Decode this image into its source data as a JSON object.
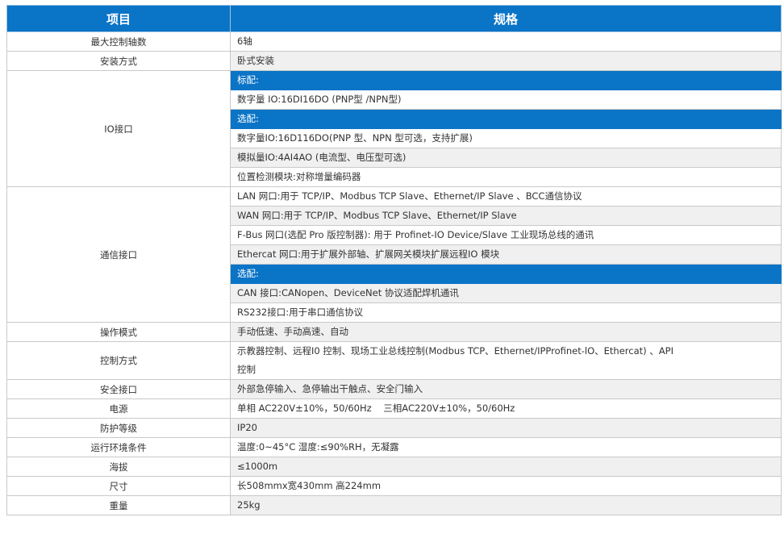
{
  "header": {
    "col1": "项目",
    "col2": "规格"
  },
  "rows": {
    "axes": {
      "label": "最大控制轴数",
      "value": "6轴"
    },
    "install": {
      "label": "安装方式",
      "value": "卧式安装"
    },
    "io": {
      "label": "IO接口",
      "std_title": "标配:",
      "std_digital": "数字量 IO:16DI16DO (PNP型 /NPN型)",
      "opt_title": "选配:",
      "opt_digital": "数字量IO:16D116DO(PNP 型、NPN 型可选，支持扩展)",
      "opt_analog": "模拟量IO:4AI4AO (电流型、电压型可选)",
      "opt_position": "位置检测模块:对称增量编码器"
    },
    "comm": {
      "label": "通信接口",
      "lan": "LAN 网口:用于 TCP/IP、Modbus TCP Slave、Ethernet/IP Slave 、BCC通信协议",
      "wan": "WAN 网口:用于 TCP/IP、Modbus TCP Slave、Ethernet/IP Slave",
      "fbus": "F-Bus 网口(选配 Pro 版控制器): 用于 Profinet-IO Device/Slave 工业现场总线的通讯",
      "ethercat": "Ethercat 网口:用于扩展外部轴、扩展网关模块扩展远程IO 模块",
      "opt_title": "选配:",
      "can": "CAN 接口:CANopen、DeviceNet 协议适配焊机通讯",
      "rs232": "RS232接口:用于串口通信协议"
    },
    "mode": {
      "label": "操作模式",
      "value": "手动低速、手动高速、自动"
    },
    "control": {
      "label": "控制方式",
      "value_line1": "示教器控制、远程I0 控制、现场工业总线控制(Modbus TCP、Ethernet/IPProfinet-lO、Ethercat) 、API",
      "value_line2": "控制"
    },
    "safety": {
      "label": "安全接口",
      "value": "外部急停输入、急停输出干触点、安全门输入"
    },
    "power": {
      "label": "电源",
      "value": "单相 AC220V±10%，50/60Hz    三相AC220V±10%，50/60Hz"
    },
    "protection": {
      "label": "防护等级",
      "value": "IP20"
    },
    "environment": {
      "label": "运行环境条件",
      "value": "温度:0~45°C 湿度:≤90%RH，无凝露"
    },
    "altitude": {
      "label": "海拔",
      "value": "≤1000m"
    },
    "size": {
      "label": "尺寸",
      "value": "长508mmx宽430mm 高224mm"
    },
    "weight": {
      "label": "重量",
      "value": "25kg"
    }
  },
  "colors": {
    "header_bg": "#0a74c7",
    "highlight_bg": "#0a74c7",
    "alt_row_bg": "#f0f0f0",
    "border": "#c9c9c9"
  }
}
